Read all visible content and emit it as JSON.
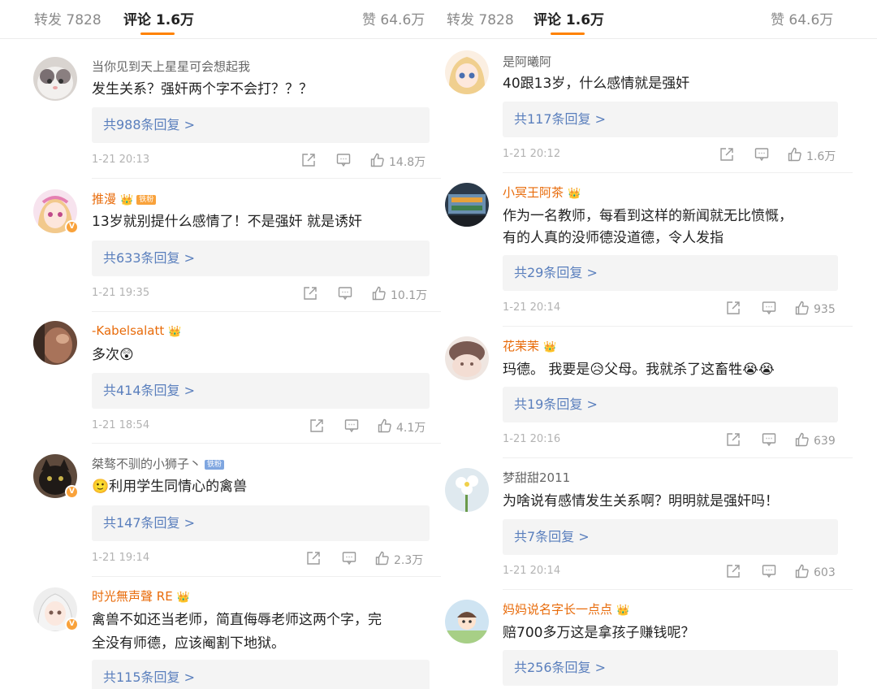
{
  "colors": {
    "accent": "#ff8200",
    "name_orange": "#e86b0a",
    "name_gray": "#666666",
    "link": "#5a7fbd",
    "vip": "#f9a23b"
  },
  "header": {
    "repost_label": "转发",
    "repost_count": "7828",
    "comment_label": "评论",
    "comment_count": "1.6万",
    "like_label": "赞",
    "like_count": "64.6万"
  },
  "icons": {
    "share": "share-icon",
    "comment": "comment-icon",
    "like": "thumbs-up-icon",
    "crown": "crown-icon"
  },
  "left": [
    {
      "name": "当你见到天上星星可会想起我",
      "text": "发生关系？强奸两个字不会打？？？",
      "replies": "共988条回复 >",
      "time": "1-21 20:13",
      "likes": "14.8万"
    },
    {
      "name": "推漫",
      "fan_badge": "铁粉",
      "text": "13岁就别提什么感情了！不是强奸 就是诱奸",
      "replies": "共633条回复 >",
      "time": "1-21 19:35",
      "likes": "10.1万"
    },
    {
      "name": "-Kabelsalatt",
      "text": "多次😲",
      "replies": "共414条回复 >",
      "time": "1-21 18:54",
      "likes": "4.1万"
    },
    {
      "name": "桀骜不驯的小狮子丶",
      "fan_badge": "铁粉",
      "text": "🙂利用学生同情心的禽兽",
      "replies": "共147条回复 >",
      "time": "1-21 19:14",
      "likes": "2.3万"
    },
    {
      "name": "时光無声聲 RE",
      "text_line1": "禽兽不如还当老师，简直侮辱老师这两个字，完",
      "text_line2": "全没有师德，应该阉割下地狱。",
      "replies": "共115条回复 >"
    }
  ],
  "right": [
    {
      "name": "是阿曦阿",
      "text": "40跟13岁，什么感情就是强奸",
      "replies": "共117条回复 >",
      "time": "1-21 20:12",
      "likes": "1.6万"
    },
    {
      "name": "小冥王阿茶",
      "text_line1": "作为一名教师，每看到这样的新闻就无比愤慨，",
      "text_line2": "有的人真的没师德没道德，令人发指",
      "replies": "共29条回复 >",
      "time": "1-21 20:14",
      "likes": "935"
    },
    {
      "name": "花茉茉",
      "text": "玛德。 我要是😥父母。我就杀了这畜牲😭😭",
      "replies": "共19条回复 >",
      "time": "1-21 20:16",
      "likes": "639"
    },
    {
      "name": "梦甜甜2011",
      "text": "为啥说有感情发生关系啊？明明就是强奸吗！",
      "replies": "共7条回复 >",
      "time": "1-21 20:14",
      "likes": "603"
    },
    {
      "name": "妈妈说名字长一点点",
      "text": "赔700多万这是拿孩子赚钱呢？",
      "replies": "共256条回复 >"
    }
  ]
}
